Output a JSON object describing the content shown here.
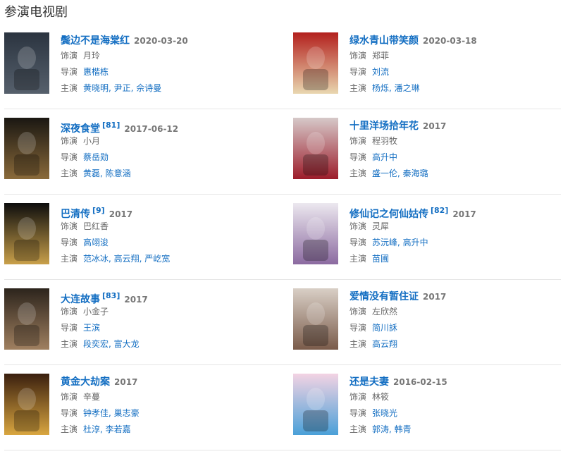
{
  "section_title": "参演电视剧",
  "items": [
    {
      "title": "鬓边不是海棠红",
      "sup": "",
      "date": "2020-03-20",
      "role_label": "饰演",
      "role": "月玲",
      "director_label": "导演",
      "director": "惠楷栋",
      "cast_label": "主演",
      "cast": "黄晓明, 尹正, 佘诗曼",
      "poster_colors": [
        "#2b3440",
        "#56606c"
      ]
    },
    {
      "title": "绿水青山带笑颜",
      "sup": "",
      "date": "2020-03-18",
      "role_label": "饰演",
      "role": "郑菲",
      "director_label": "导演",
      "director": "刘流",
      "cast_label": "主演",
      "cast": "杨烁, 潘之琳",
      "poster_colors": [
        "#b3201d",
        "#e9d7b0"
      ]
    },
    {
      "title": "深夜食堂",
      "sup": "[81]",
      "date": "2017-06-12",
      "role_label": "饰演",
      "role": "小月",
      "director_label": "导演",
      "director": "蔡岳勋",
      "cast_label": "主演",
      "cast": "黄磊, 陈意涵",
      "poster_colors": [
        "#1a1712",
        "#8a6a3a"
      ]
    },
    {
      "title": "十里洋场拾年花",
      "sup": "",
      "date": "2017",
      "role_label": "饰演",
      "role": "程羽牧",
      "director_label": "导演",
      "director": "高升中",
      "cast_label": "主演",
      "cast": "盛一伦, 秦海璐",
      "poster_colors": [
        "#d6c9c9",
        "#9c1c2a"
      ]
    },
    {
      "title": "巴清传",
      "sup": "[9]",
      "date": "2017",
      "role_label": "饰演",
      "role": "巴红香",
      "director_label": "导演",
      "director": "高翊浚",
      "cast_label": "主演",
      "cast": "范冰冰, 高云翔, 严屹宽",
      "poster_colors": [
        "#0d0d0d",
        "#c9a04a"
      ]
    },
    {
      "title": "修仙记之何仙姑传",
      "sup": "[82]",
      "date": "2017",
      "role_label": "饰演",
      "role": "灵犀",
      "director_label": "导演",
      "director": "苏沅峰, 高升中",
      "cast_label": "主演",
      "cast": "苗圃",
      "poster_colors": [
        "#ece8ef",
        "#8b6aa0"
      ]
    },
    {
      "title": "大连故事",
      "sup": "[83]",
      "date": "2017",
      "role_label": "饰演",
      "role": "小金子",
      "director_label": "导演",
      "director": "王滨",
      "cast_label": "主演",
      "cast": "段奕宏, 富大龙",
      "poster_colors": [
        "#2c241c",
        "#a08060"
      ]
    },
    {
      "title": "爱情没有暂住证",
      "sup": "",
      "date": "2017",
      "role_label": "饰演",
      "role": "左欣然",
      "director_label": "导演",
      "director": "简川訸",
      "cast_label": "主演",
      "cast": "高云翔",
      "poster_colors": [
        "#d9cfc6",
        "#7a5b4a"
      ]
    },
    {
      "title": "黄金大劫案",
      "sup": "",
      "date": "2017",
      "role_label": "饰演",
      "role": "辛蔓",
      "director_label": "导演",
      "director": "钟孝佳, 巢志豪",
      "cast_label": "主演",
      "cast": "杜淳, 李若嘉",
      "poster_colors": [
        "#3a1f0e",
        "#d9a640"
      ]
    },
    {
      "title": "还是夫妻",
      "sup": "",
      "date": "2016-02-15",
      "role_label": "饰演",
      "role": "林筱",
      "director_label": "导演",
      "director": "张晓光",
      "cast_label": "主演",
      "cast": "郭涛, 韩青",
      "poster_colors": [
        "#f3d3e3",
        "#4aa0d8"
      ]
    }
  ]
}
